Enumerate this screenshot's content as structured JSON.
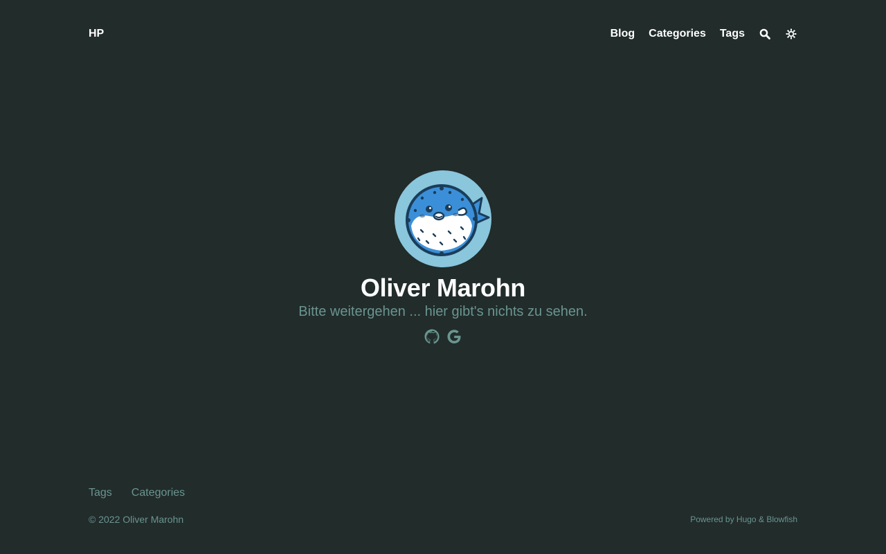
{
  "header": {
    "brand": "HP",
    "nav": [
      {
        "label": "Blog"
      },
      {
        "label": "Categories"
      },
      {
        "label": "Tags"
      }
    ],
    "search_icon": "search-icon",
    "theme_icon": "sun-icon"
  },
  "hero": {
    "avatar_icon": "pufferfish-avatar",
    "name": "Oliver Marohn",
    "tagline": "Bitte weitergehen ... hier gibt's nichts zu sehen.",
    "socials": [
      {
        "icon": "github-icon"
      },
      {
        "icon": "google-icon"
      }
    ]
  },
  "footer": {
    "nav": [
      {
        "label": "Tags"
      },
      {
        "label": "Categories"
      }
    ],
    "copyright": "© 2022 Oliver Marohn",
    "powered_prefix": "Powered by",
    "powered_hugo": "Hugo",
    "powered_amp": "&",
    "powered_blowfish": "Blowfish"
  },
  "colors": {
    "background": "#212c2b",
    "primary_text": "#ffffff",
    "muted_text": "#6b9590",
    "avatar_bg": "#8ac6dc"
  }
}
